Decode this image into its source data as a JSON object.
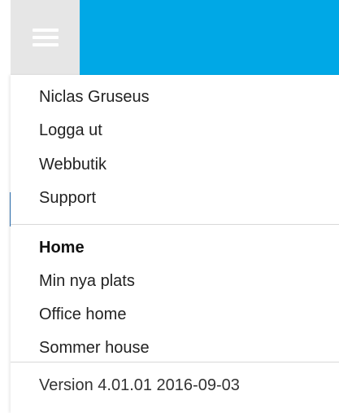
{
  "header": {
    "menu_icon": "hamburger-icon",
    "bar_color": "#00a8e6",
    "button_color": "#e6e6e6"
  },
  "account_menu": {
    "items": [
      {
        "label": "Niclas Gruseus"
      },
      {
        "label": "Logga ut"
      },
      {
        "label": "Webbutik"
      },
      {
        "label": "Support"
      }
    ]
  },
  "locations_menu": {
    "items": [
      {
        "label": "Home",
        "selected": true
      },
      {
        "label": "Min nya plats"
      },
      {
        "label": "Office home"
      },
      {
        "label": "Sommer house"
      }
    ]
  },
  "footer": {
    "version_text": "Version 4.01.01 2016-09-03"
  }
}
